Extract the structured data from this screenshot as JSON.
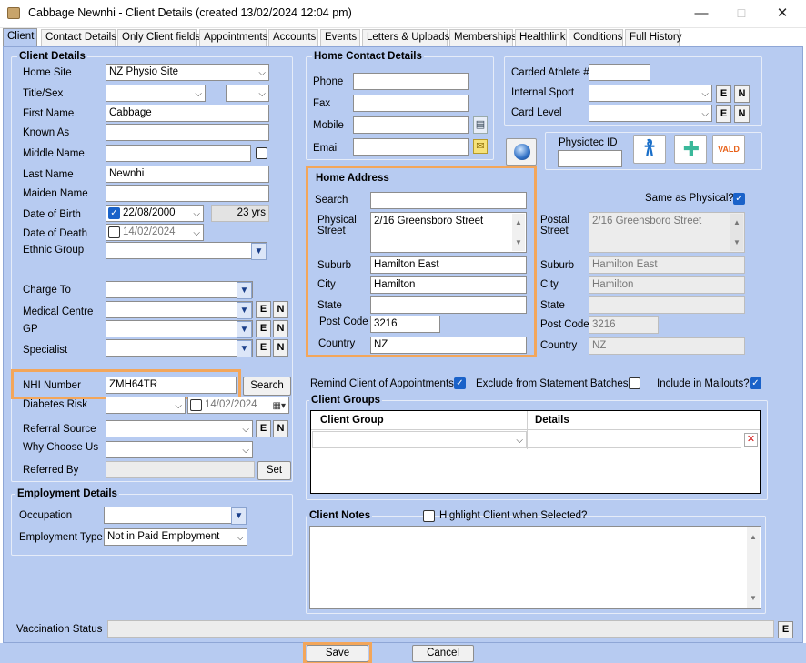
{
  "window": {
    "title": "Cabbage Newnhi - Client Details (created 13/02/2024 12:04 pm)",
    "minimize": "—",
    "maximize": "☐",
    "close": "✕"
  },
  "tabs": [
    {
      "label": "Client"
    },
    {
      "label": "Contact Details"
    },
    {
      "label": "Only Client fields"
    },
    {
      "label": "Appointments"
    },
    {
      "label": "Accounts"
    },
    {
      "label": "Events"
    },
    {
      "label": "Letters & Uploads"
    },
    {
      "label": "Memberships"
    },
    {
      "label": "Healthlink"
    },
    {
      "label": "Conditions"
    },
    {
      "label": "Full History"
    }
  ],
  "client_details": {
    "title": "Client Details",
    "home_site": {
      "label": "Home Site",
      "value": "NZ Physio Site"
    },
    "title_sex": {
      "label": "Title/Sex"
    },
    "first_name": {
      "label": "First Name",
      "value": "Cabbage"
    },
    "known_as": {
      "label": "Known As"
    },
    "middle_name": {
      "label": "Middle Name"
    },
    "last_name": {
      "label": "Last Name",
      "value": "Newnhi"
    },
    "maiden_name": {
      "label": "Maiden Name"
    },
    "date_of_birth": {
      "label": "Date of Birth",
      "value": "22/08/2000",
      "age": "23 yrs"
    },
    "date_of_death": {
      "label": "Date of Death",
      "value": "14/02/2024"
    },
    "ethnic_group": {
      "label": "Ethnic Group"
    },
    "charge_to": {
      "label": "Charge To"
    },
    "medical_centre": {
      "label": "Medical Centre"
    },
    "gp": {
      "label": "GP"
    },
    "specialist": {
      "label": "Specialist"
    },
    "nhi_number": {
      "label": "NHI Number",
      "value": "ZMH64TR",
      "search_label": "Search"
    },
    "diabetes_risk": {
      "label": "Diabetes Risk",
      "date": "14/02/2024"
    },
    "referral_source": {
      "label": "Referral Source"
    },
    "why_choose_us": {
      "label": "Why Choose Us"
    },
    "referred_by": {
      "label": "Referred By",
      "set_label": "Set"
    },
    "e_label": "E",
    "n_label": "N"
  },
  "employment": {
    "title": "Employment Details",
    "occupation": {
      "label": "Occupation"
    },
    "employment_type": {
      "label": "Employment Type",
      "value": "Not in Paid Employment"
    }
  },
  "home_contact": {
    "title": "Home Contact Details",
    "phone": {
      "label": "Phone"
    },
    "fax": {
      "label": "Fax"
    },
    "mobile": {
      "label": "Mobile"
    },
    "email": {
      "label": "Emai"
    }
  },
  "athlete": {
    "carded_athlete": {
      "label": "Carded Athlete #"
    },
    "internal_sport": {
      "label": "Internal Sport"
    },
    "card_level": {
      "label": "Card Level"
    },
    "physiotec_id": {
      "label": "Physiotec ID"
    },
    "vald_label": "VALD"
  },
  "home_address": {
    "title": "Home Address",
    "search": {
      "label": "Search"
    },
    "physical_street": {
      "label1": "Physical",
      "label2": "Street",
      "value": "2/16 Greensboro Street"
    },
    "suburb": {
      "label": "Suburb",
      "value": "Hamilton East"
    },
    "city": {
      "label": "City",
      "value": "Hamilton"
    },
    "state": {
      "label": "State"
    },
    "post_code": {
      "label": "Post Code",
      "value": "3216"
    },
    "country": {
      "label": "Country",
      "value": "NZ"
    }
  },
  "postal_address": {
    "same_as_physical": "Same as Physical?",
    "postal_street": {
      "label1": "Postal",
      "label2": "Street",
      "value": "2/16 Greensboro Street"
    },
    "suburb": {
      "label": "Suburb",
      "value": "Hamilton East"
    },
    "city": {
      "label": "City",
      "value": "Hamilton"
    },
    "state": {
      "label": "State"
    },
    "post_code": {
      "label": "Post Code",
      "value": "3216"
    },
    "country": {
      "label": "Country",
      "value": "NZ"
    }
  },
  "options": {
    "remind": "Remind Client of Appointments?",
    "exclude": "Exclude from Statement Batches?",
    "mailouts": "Include in Mailouts?"
  },
  "client_groups": {
    "title": "Client Groups",
    "col_group": "Client Group",
    "col_details": "Details",
    "delete_icon": "✕"
  },
  "client_notes": {
    "title": "Client Notes",
    "highlight": "Highlight Client when Selected?"
  },
  "vaccination": {
    "label": "Vaccination Status",
    "e_label": "E"
  },
  "actions": {
    "save": "Save",
    "cancel": "Cancel"
  },
  "colors": {
    "background": "#b7cbf1",
    "highlight": "#f3a65a",
    "check_blue": "#1a62c9"
  },
  "icons": [
    "app-icon",
    "calculator-icon",
    "envelope-icon",
    "globe-icon",
    "physiotec-figure-icon",
    "plus-arrows-icon",
    "vald-logo"
  ]
}
